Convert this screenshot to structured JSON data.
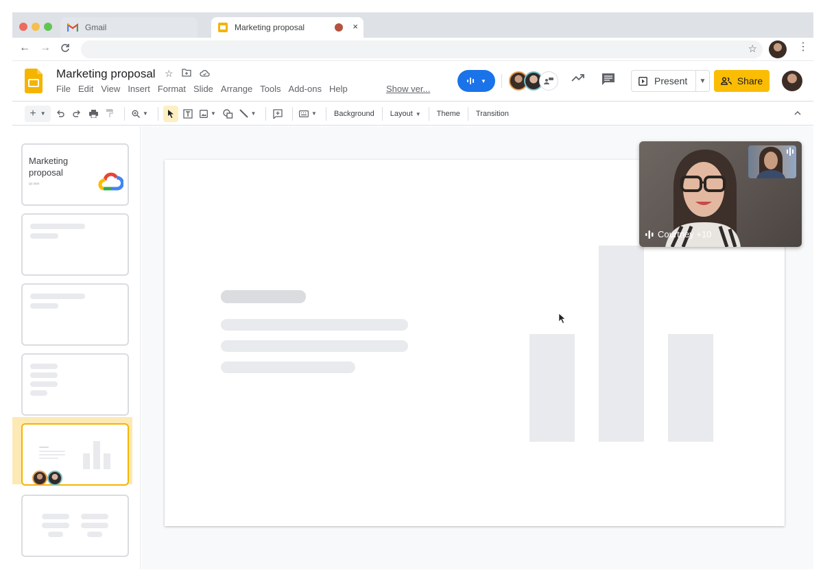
{
  "browser": {
    "tabs": [
      {
        "label": "Gmail",
        "icon": "gmail-icon",
        "active": false
      },
      {
        "label": "Marketing proposal",
        "icon": "slides-icon",
        "active": true,
        "recording": true
      }
    ],
    "close_glyph": "×",
    "nav": {
      "back": "←",
      "forward": "→",
      "reload": "C"
    },
    "star_glyph": "☆",
    "menu_glyph": "⋮"
  },
  "doc": {
    "title": "Marketing proposal",
    "menu": [
      "File",
      "Edit",
      "View",
      "Insert",
      "Format",
      "Slide",
      "Arrange",
      "Tools",
      "Add-ons",
      "Help"
    ],
    "show_version": "Show ver...",
    "present_label": "Present",
    "share_label": "Share",
    "colors": {
      "meet_blue": "#1a73e8",
      "share_yellow": "#fbbc04",
      "selection_yellow": "#f4b400"
    }
  },
  "toolbar": {
    "new_slide": "+",
    "text_buttons": [
      "Background",
      "Layout",
      "Theme",
      "Transition"
    ],
    "collapse_glyph": "^"
  },
  "filmstrip": {
    "slides": [
      {
        "index": 1,
        "title": "Marketing proposal",
        "subtitle": "Q2 2020",
        "active": false
      },
      {
        "index": 2,
        "active": false
      },
      {
        "index": 3,
        "active": false
      },
      {
        "index": 4,
        "active": false
      },
      {
        "index": 5,
        "active": true
      },
      {
        "index": 6,
        "active": false
      }
    ]
  },
  "slide_chart": {
    "type": "bar",
    "bars": [
      0.55,
      1.0,
      0.55
    ]
  },
  "video": {
    "name_label": "Courtney +10"
  }
}
